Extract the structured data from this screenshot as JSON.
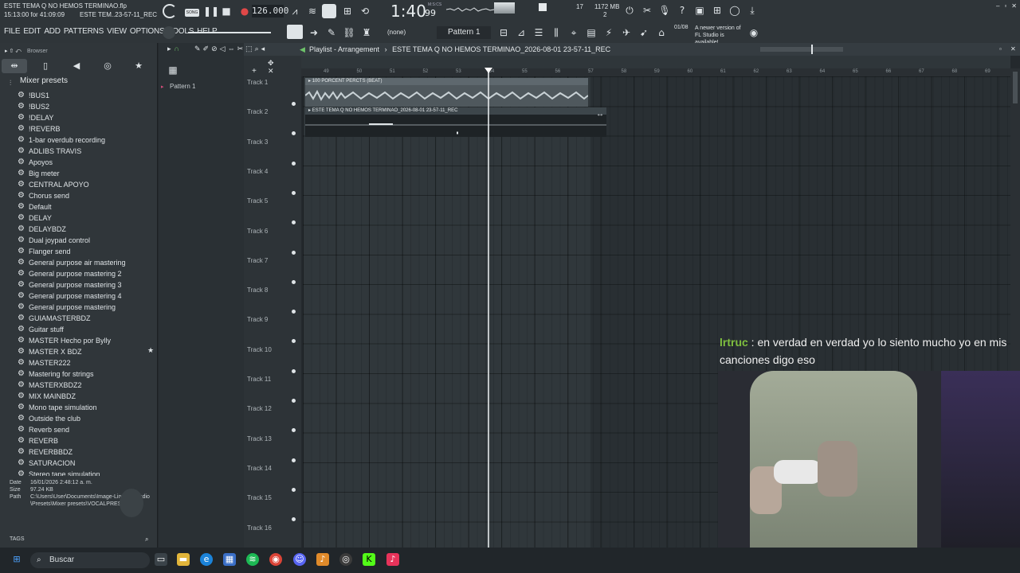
{
  "window": {
    "project_title": "ESTE TEMA Q NO HEMOS TERMINAO.flp",
    "time_info": "15:13:00 for 41:09:09",
    "hint_file": "ESTE TEM..23-57-11_REC"
  },
  "menu": [
    "FILE",
    "EDIT",
    "ADD",
    "PATTERNS",
    "VIEW",
    "OPTIONS",
    "TOOLS",
    "HELP"
  ],
  "transport": {
    "song_mode": "SONG",
    "tempo": "126.000",
    "clock_main": "1:40",
    "clock_sub": "99",
    "clock_unit": "M:S:CS",
    "cpu_num": "17",
    "memory": "1172 MB",
    "voices": "2"
  },
  "toolbar": {
    "snap_label": "(none)",
    "pattern_label": "Pattern 1",
    "update_date": "01/08",
    "update_note": "A newer version of FL Studio is available!"
  },
  "browser": {
    "title": "Browser",
    "section_title": "Mixer presets",
    "presets": [
      "!BUS1",
      "!BUS2",
      "!DELAY",
      "!REVERB",
      "1-bar overdub recording",
      "ADLIBS TRAVIS",
      "Apoyos",
      "Big meter",
      "CENTRAL APOYO",
      "Chorus send",
      "Default",
      "DELAY",
      "DELAYBDZ",
      "Dual joypad control",
      "Flanger send",
      "General purpose air mastering",
      "General purpose mastering 2",
      "General purpose mastering 3",
      "General purpose mastering 4",
      "General purpose mastering",
      "GUIAMASTERBDZ",
      "Guitar stuff",
      "MASTER Hecho por Bylly",
      "MASTER X BDZ",
      "MASTER222",
      "Mastering for strings",
      "MASTERXBDZ2",
      "MIX MAINBDZ",
      "Mono tape simulation",
      "Outside the club",
      "Reverb send",
      "REVERB",
      "REVERBBDZ",
      "SATURACION",
      "Stereo tape simulation"
    ],
    "info": {
      "date_label": "Date",
      "date_value": "16/01/2026 2:48:12 a. m.",
      "size_label": "Size",
      "size_value": "97.24 KB",
      "path_label": "Path",
      "path_value": "C:\\Users\\User\\Documents\\Image-Line\\FL Studio\\Presets\\Mixer presets\\VOCALPRESET2.fst"
    },
    "tags_label": "TAGS"
  },
  "pattern_panel": {
    "item": "Pattern 1"
  },
  "playlist": {
    "title": "Playlist - Arrangement",
    "arrangement_name": "ESTE TEMA Q NO HEMOS TERMINAO_2026-08-01 23-57-11_REC",
    "bar_numbers": [
      "49",
      "50",
      "51",
      "52",
      "53",
      "54",
      "55",
      "56",
      "57",
      "58",
      "59",
      "60",
      "61",
      "62",
      "63",
      "64",
      "65",
      "66",
      "67",
      "68",
      "69"
    ],
    "tracks": [
      "Track 1",
      "Track 2",
      "Track 3",
      "Track 4",
      "Track 5",
      "Track 6",
      "Track 7",
      "Track 8",
      "Track 9",
      "Track 10",
      "Track 11",
      "Track 12",
      "Track 13",
      "Track 14",
      "Track 15",
      "Track 16"
    ],
    "clips": [
      {
        "name": "100 PORCENT PERCTS (BEAT)"
      },
      {
        "name": "ESTE TEMA Q NO HEMOS TERMINAO_2026-08-01 23-57-11_REC"
      }
    ]
  },
  "chat": {
    "user": "lrtruc",
    "message": "en verdad en verdad yo lo siento mucho yo en mis canciones digo eso"
  },
  "taskbar": {
    "search_placeholder": "Buscar"
  }
}
